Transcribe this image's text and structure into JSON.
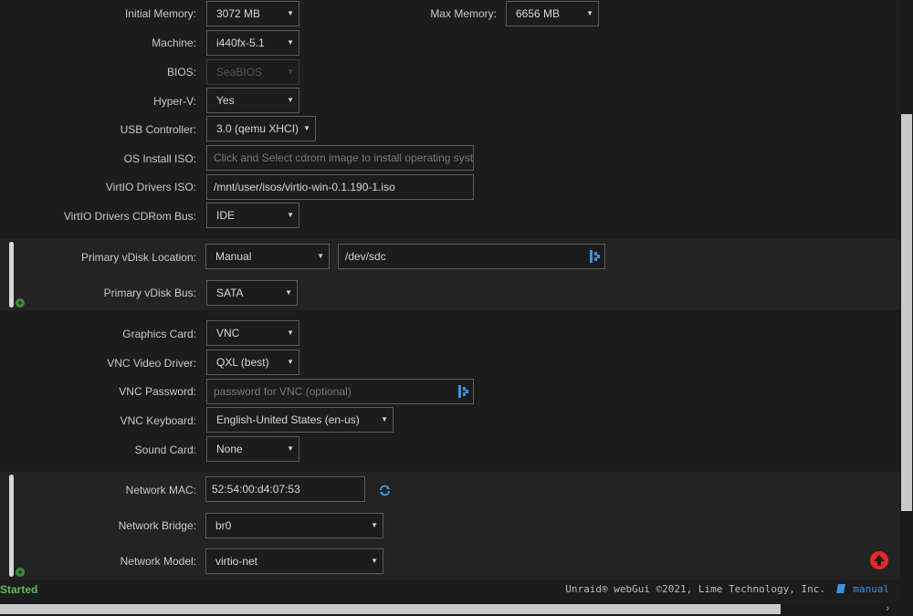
{
  "settings": {
    "initial_memory": {
      "label": "Initial Memory:",
      "value": "3072 MB"
    },
    "max_memory": {
      "label": "Max Memory:",
      "value": "6656 MB"
    },
    "machine": {
      "label": "Machine:",
      "value": "i440fx-5.1"
    },
    "bios": {
      "label": "BIOS:",
      "value": "SeaBIOS"
    },
    "hyperv": {
      "label": "Hyper-V:",
      "value": "Yes"
    },
    "usb_controller": {
      "label": "USB Controller:",
      "value": "3.0 (qemu XHCI)"
    },
    "os_install_iso": {
      "label": "OS Install ISO:",
      "placeholder": "Click and Select cdrom image to install operating system"
    },
    "virtio_iso": {
      "label": "VirtIO Drivers ISO:",
      "value": "/mnt/user/isos/virtio-win-0.1.190-1.iso"
    },
    "virtio_bus": {
      "label": "VirtIO Drivers CDRom Bus:",
      "value": "IDE"
    }
  },
  "vdisk": {
    "location_label": "Primary vDisk Location:",
    "location_value": "Manual",
    "path_value": "/dev/sdc",
    "bus_label": "Primary vDisk Bus:",
    "bus_value": "SATA"
  },
  "graphics": {
    "card": {
      "label": "Graphics Card:",
      "value": "VNC"
    },
    "driver": {
      "label": "VNC Video Driver:",
      "value": "QXL (best)"
    },
    "password": {
      "label": "VNC Password:",
      "placeholder": "password for VNC (optional)"
    },
    "keyboard": {
      "label": "VNC Keyboard:",
      "value": "English-United States (en-us)"
    },
    "sound": {
      "label": "Sound Card:",
      "value": "None"
    }
  },
  "network": {
    "mac": {
      "label": "Network MAC:",
      "value": "52:54:00:d4:07:53"
    },
    "bridge": {
      "label": "Network Bridge:",
      "value": "br0"
    },
    "model": {
      "label": "Network Model:",
      "value": "virtio-net"
    }
  },
  "footer": {
    "status": "Started",
    "copyright": "Unraid® webGui ©2021, Lime Technology, Inc.",
    "manual": "manual"
  },
  "colors": {
    "accent": "#3c91e6",
    "status_green": "#5cb85c",
    "scroll_top_red": "#e22828"
  }
}
